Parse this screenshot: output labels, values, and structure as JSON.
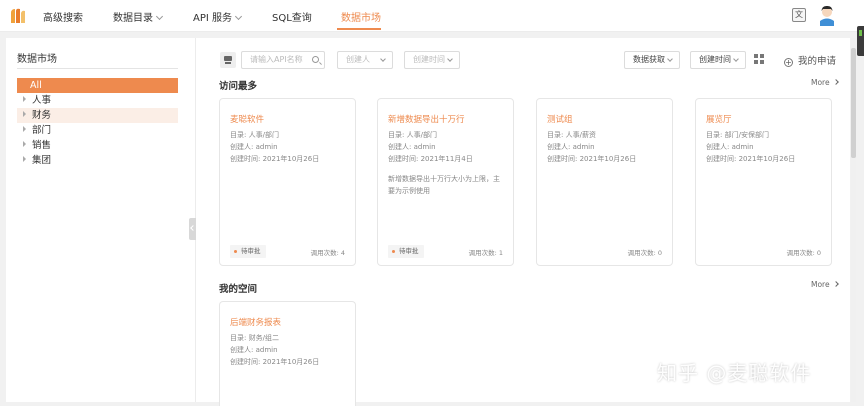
{
  "nav": {
    "items": [
      {
        "label": "高级搜索"
      },
      {
        "label": "数据目录"
      },
      {
        "label": "API 服务"
      },
      {
        "label": "SQL查询"
      },
      {
        "label": "数据市场"
      }
    ],
    "active_index": 4,
    "translate_icon": "文"
  },
  "sidebar": {
    "title": "数据市场",
    "items": [
      {
        "label": "All",
        "selected": true
      },
      {
        "label": "人事"
      },
      {
        "label": "财务",
        "highlighted": true
      },
      {
        "label": "部门"
      },
      {
        "label": "销售"
      },
      {
        "label": "集团"
      }
    ]
  },
  "filters": {
    "search_placeholder": "请输入API名称",
    "creator_placeholder": "创建人",
    "created_time_placeholder": "创建时间",
    "fetch_label": "数据获取",
    "sort_label": "创建时间",
    "apply_label": "我的申请"
  },
  "sections": {
    "most_visited": {
      "title": "访问最多",
      "more": "More",
      "cards": [
        {
          "title": "麦聪软件",
          "catalog": "目录: 人事/部门",
          "creator": "创建人: admin",
          "created": "创建时间: 2021年10月26日",
          "desc": "",
          "badge": "待审批",
          "calls": "调用次数: 4"
        },
        {
          "title": "新增数据导出十万行",
          "catalog": "目录: 人事/部门",
          "creator": "创建人: admin",
          "created": "创建时间: 2021年11月4日",
          "desc": "新增数据导出十万行大小为上限，主要为示例使用",
          "badge": "待审批",
          "calls": "调用次数: 1"
        },
        {
          "title": "测试组",
          "catalog": "目录: 人事/薪资",
          "creator": "创建人: admin",
          "created": "创建时间: 2021年10月26日",
          "desc": "",
          "badge": "",
          "calls": "调用次数: 0"
        },
        {
          "title": "展览厅",
          "catalog": "目录: 部门/安保部门",
          "creator": "创建人: admin",
          "created": "创建时间: 2021年10月26日",
          "desc": "",
          "badge": "",
          "calls": "调用次数: 0"
        }
      ]
    },
    "my_space": {
      "title": "我的空间",
      "more": "More",
      "cards": [
        {
          "title": "后端财务报表",
          "catalog": "目录: 财务/组二",
          "creator": "创建人: admin",
          "created": "创建时间: 2021年10月26日"
        }
      ]
    }
  },
  "watermark": "知乎 @麦聪软件",
  "colors": {
    "accent": "#ee8a4e",
    "accent_light": "#fbeee6",
    "text": "#333333",
    "muted": "#888888",
    "border": "#e6e6e6"
  }
}
